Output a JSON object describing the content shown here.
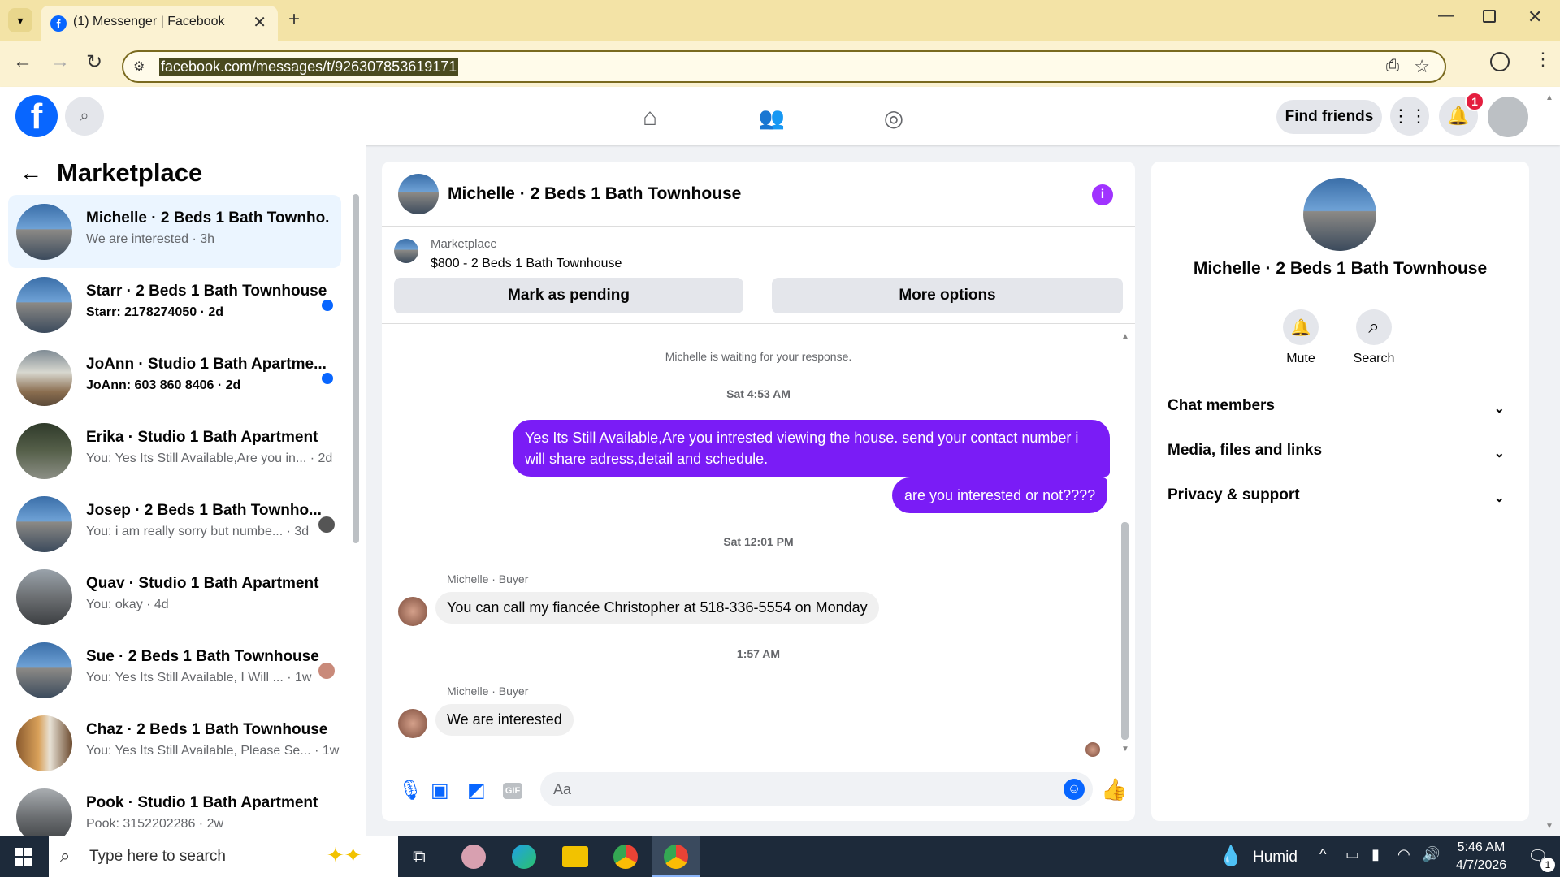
{
  "browser": {
    "tab_title": "(1) Messenger | Facebook",
    "url": "facebook.com/messages/t/926307853619171"
  },
  "header": {
    "find_friends": "Find friends",
    "notif_count": "1"
  },
  "sidebar": {
    "title": "Marketplace",
    "conversations": [
      {
        "name": "Michelle · 2 Beds 1 Bath Townho...",
        "preview": "We are interested · 3h",
        "unread": false
      },
      {
        "name": "Starr · 2 Beds 1 Bath Townhouse",
        "preview": "Starr: 2178274050 · 2d",
        "unread": true
      },
      {
        "name": "JoAnn · Studio 1 Bath Apartme...",
        "preview": "JoAnn: 603 860 8406 · 2d",
        "unread": true
      },
      {
        "name": "Erika · Studio 1 Bath Apartment",
        "preview": "You: Yes Its Still Available,Are you in... · 2d",
        "unread": false
      },
      {
        "name": "Josep · 2 Beds 1 Bath Townho...",
        "preview": "You: i am really sorry but numbe... · 3d",
        "unread": false
      },
      {
        "name": "Quav · Studio 1 Bath Apartment",
        "preview": "You: okay · 4d",
        "unread": false
      },
      {
        "name": "Sue · 2 Beds 1 Bath Townhouse",
        "preview": "You: Yes Its Still Available, I Will ... · 1w",
        "unread": false
      },
      {
        "name": "Chaz · 2 Beds 1 Bath Townhouse",
        "preview": "You: Yes Its Still Available, Please Se... · 1w",
        "unread": false
      },
      {
        "name": "Pook · Studio 1 Bath Apartment",
        "preview": "Pook: 3152202286 · 2w",
        "unread": false
      }
    ]
  },
  "chat": {
    "title": "Michelle · 2 Beds 1 Bath Townhouse",
    "listing_source": "Marketplace",
    "listing": "$800 - 2 Beds 1 Bath Townhouse",
    "mark_pending": "Mark as pending",
    "more_options": "More options",
    "waiting": "Michelle is waiting for your response.",
    "time1": "Sat 4:53 AM",
    "out1_line1": "Yes Its Still Available,Are you intrested viewing the house. send your contact number i",
    "out1_line2": "will share adress,detail and schedule.",
    "out2": "are you interested or not????",
    "time2": "Sat 12:01 PM",
    "sender": "Michelle · Buyer",
    "in1": "You can call my fiancée Christopher at 518-336-5554 on Monday",
    "time3": "1:57 AM",
    "in2": "We are interested",
    "composer_placeholder": "Aa"
  },
  "info": {
    "name": "Michelle · 2 Beds 1 Bath Townhouse",
    "mute": "Mute",
    "search": "Search",
    "sections": [
      "Chat members",
      "Media, files and links",
      "Privacy & support"
    ]
  },
  "taskbar": {
    "search_placeholder": "Type here to search",
    "weather": "Humid",
    "time": "5:46 AM",
    "date": "4/7/2026",
    "notif": "1"
  },
  "colors": {
    "accent": "#7a1cf6",
    "fb_blue": "#0866ff"
  }
}
